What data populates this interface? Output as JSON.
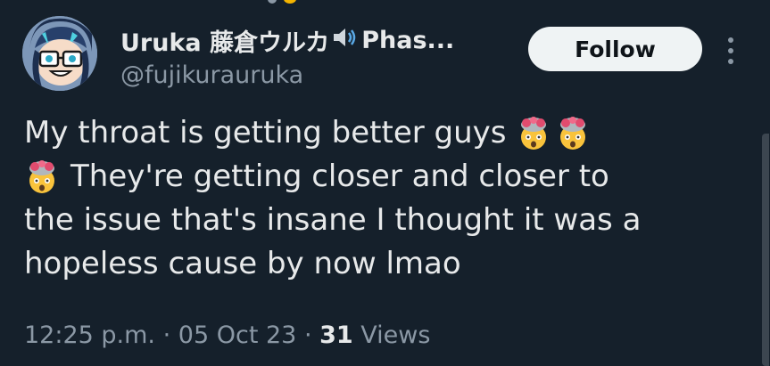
{
  "tweet": {
    "author": {
      "display_name": "Uruka 藤倉ウルカ",
      "name_suffix": "Phas...",
      "speaker_icon": "speaker-icon",
      "handle": "@fujikurauruka"
    },
    "follow_label": "Follow",
    "text_lines": [
      {
        "text": "My throat is getting better guys",
        "emoji_after": 2
      },
      {
        "text": "They're getting closer and closer to",
        "emoji_before": 1
      },
      {
        "text": "the issue that's insane I thought it was a"
      },
      {
        "text": "hopeless cause by now lmao"
      }
    ],
    "emoji": "exploding-head-emoji",
    "time": "12:25 p.m.",
    "date": "05 Oct 23",
    "views_count": "31",
    "views_label": "Views",
    "separator": "·"
  },
  "colors": {
    "background": "#15202b",
    "text": "#e7e9ea",
    "secondary": "#8b98a5",
    "button_bg": "#eff3f4"
  }
}
